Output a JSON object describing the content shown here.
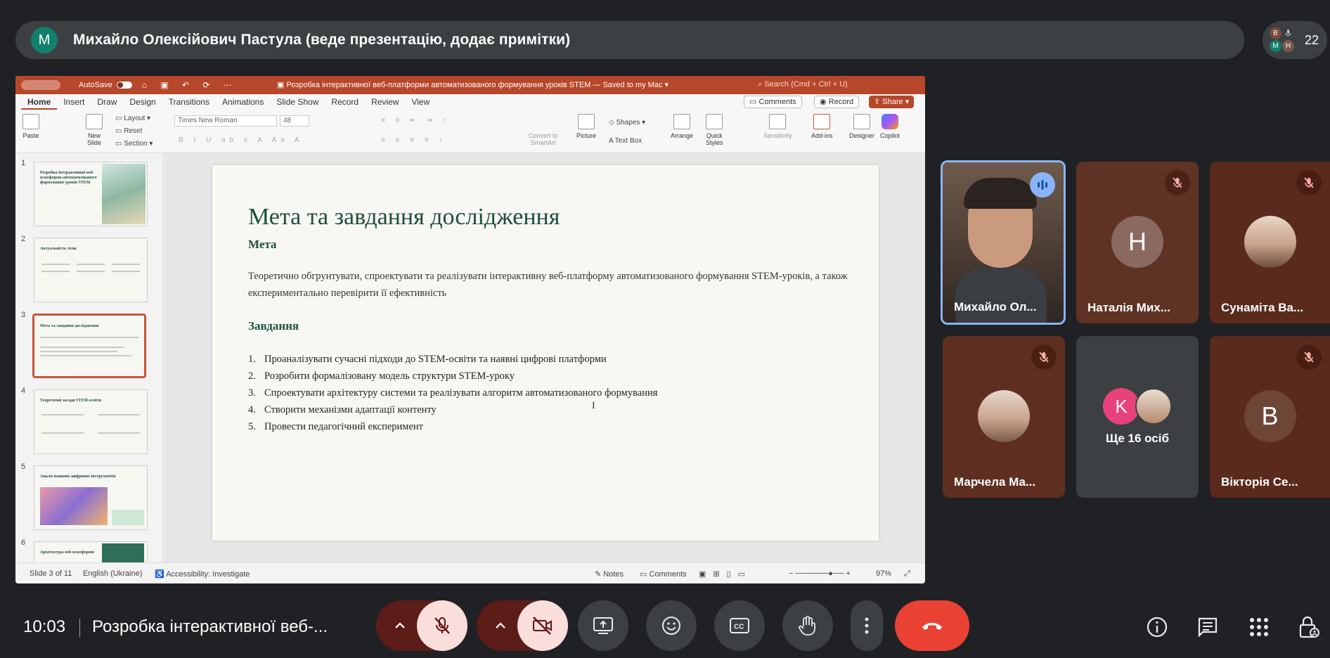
{
  "presenter": {
    "avatar_letter": "M",
    "text": "Михайло Олексійович Пастула (веде презентацію, додає примітки)",
    "people_count": "22",
    "mini_avatars": [
      "B",
      "H",
      "M"
    ]
  },
  "powerpoint": {
    "autosave_label": "AutoSave",
    "doc_title": "Розробка інтерактивної веб-платформи автоматизованого формування уроків STEM — Saved to my Mac",
    "search_placeholder": "Search (Cmd + Ctrl + U)",
    "tabs": [
      "Home",
      "Insert",
      "Draw",
      "Design",
      "Transitions",
      "Animations",
      "Slide Show",
      "Record",
      "Review",
      "View"
    ],
    "comments_btn": "Comments",
    "record_btn": "Record",
    "share_btn": "Share",
    "ribbon": {
      "paste": "Paste",
      "new_slide": "New\nSlide",
      "layout": "Layout",
      "reset": "Reset",
      "section": "Section",
      "font": "Times New Roman",
      "font_size": "48",
      "convert": "Convert to\nSmartArt",
      "picture": "Picture",
      "shapes": "Shapes",
      "text_box": "Text Box",
      "arrange": "Arrange",
      "quick_styles": "Quick\nStyles",
      "sensitivity": "Sensitivity",
      "addins": "Add-ins",
      "designer": "Designer",
      "copilot": "Copilot"
    },
    "thumbnails": [
      {
        "num": "1",
        "title": "Розробка інтерактивної веб-платформи автоматизованого формування уроків STEM"
      },
      {
        "num": "2",
        "title": "Актуальність теми"
      },
      {
        "num": "3",
        "title": "Мета та завдання дослідження"
      },
      {
        "num": "4",
        "title": "Теоретичні засади STEM-освіти"
      },
      {
        "num": "5",
        "title": "Аналіз наявних цифрових інструментів"
      },
      {
        "num": "6",
        "title": "Архітектура веб-платформи"
      }
    ],
    "slide": {
      "title": "Мета та завдання дослідження",
      "goal_heading": "Мета",
      "goal_text": "Теоретично обгрунтувати, спроектувати та реалізувати інтерактивну веб-платформу автоматизованого формування STEM-уроків, а також експериментально перевірити її ефективність",
      "tasks_heading": "Завдання",
      "tasks": [
        "Проаналізувати сучасні підходи до STEM-освіти та наявні цифрові платформи",
        "Розробити формалізовану модель структури STEM-уроку",
        "Спроектувати архітектуру системи та реалізувати алгоритм автоматизованого формування",
        "Створити механізми адаптації контенту",
        "Провести педагогічний експеримент"
      ]
    },
    "status": {
      "slide_of": "Slide 3 of 11",
      "language": "English (Ukraine)",
      "accessibility": "Accessibility: Investigate",
      "notes": "Notes",
      "comments": "Comments",
      "zoom": "97%"
    }
  },
  "participants": [
    {
      "name": "Михайло Ол...",
      "kind": "video",
      "speaking": true
    },
    {
      "name": "Наталія Мих...",
      "kind": "letter",
      "letter": "Н",
      "muted": true
    },
    {
      "name": "Сунаміта Ва...",
      "kind": "photo",
      "muted": true
    },
    {
      "name": "Марчела Ма...",
      "kind": "photo",
      "muted": true
    },
    {
      "name": "Ще 16 осіб",
      "kind": "more",
      "letter": "K"
    },
    {
      "name": "Вікторія Се...",
      "kind": "letter",
      "letter": "В",
      "muted": true
    }
  ],
  "bottom": {
    "time": "10:03",
    "meeting_name": "Розробка інтерактивної веб-..."
  },
  "colors": {
    "meet_bg": "#202124",
    "ppt_accent": "#b7472a",
    "slide_title": "#1f4e3d",
    "end_call": "#e94235",
    "muted_red": "#f9dedc"
  }
}
